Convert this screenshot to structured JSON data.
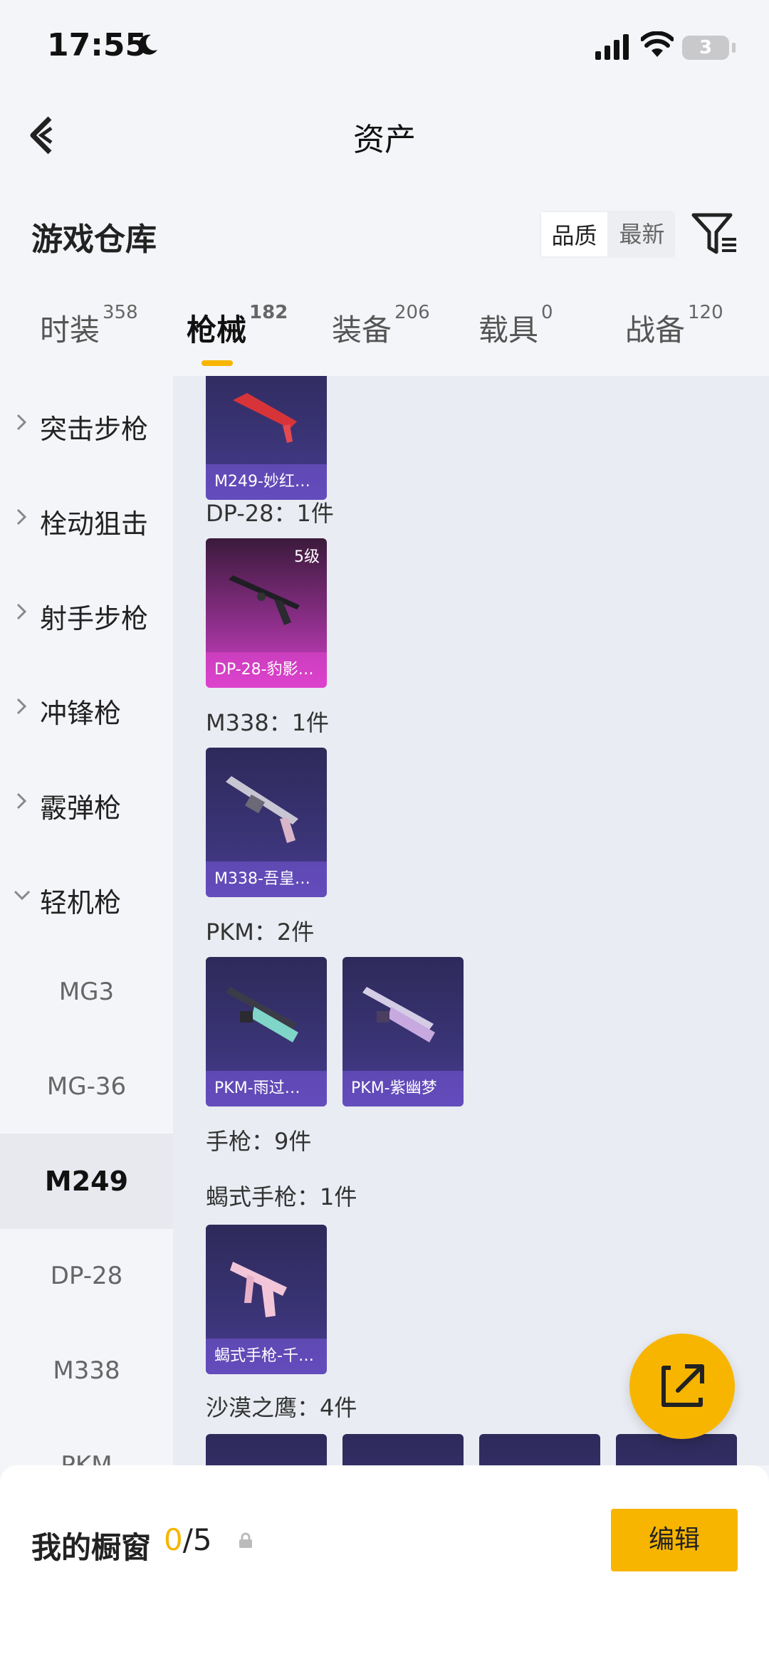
{
  "status": {
    "time": "17:55",
    "battery": "3"
  },
  "header": {
    "title": "资产"
  },
  "section": {
    "title": "游戏仓库",
    "sort_options": [
      "品质",
      "最新"
    ]
  },
  "tabs": [
    {
      "label": "时装",
      "count": "358"
    },
    {
      "label": "枪械",
      "count": "182"
    },
    {
      "label": "装备",
      "count": "206"
    },
    {
      "label": "载具",
      "count": "0"
    },
    {
      "label": "战备",
      "count": "120"
    }
  ],
  "sidebar": {
    "categories": [
      "突击步枪",
      "栓动狙击",
      "射手步枪",
      "冲锋枪",
      "霰弹枪",
      "轻机枪"
    ],
    "subitems": [
      "MG3",
      "MG-36",
      "M249",
      "DP-28",
      "M338",
      "PKM"
    ]
  },
  "content": {
    "cards": {
      "m249": "M249-妙红…",
      "dp28": "DP-28-豹影…",
      "dp28_level": "5级",
      "m338": "M338-吾皇…",
      "pkm1": "PKM-雨过…",
      "pkm2": "PKM-紫幽梦",
      "scorpion": "蝎式手枪-千…"
    },
    "groups": {
      "dp28": "DP-28：1件",
      "m338": "M338：1件",
      "pkm": "PKM：2件",
      "pistol": "手枪：9件",
      "scorpion": "蝎式手枪：1件",
      "deagle": "沙漠之鹰：4件"
    }
  },
  "showcase": {
    "label": "我的橱窗",
    "count_current": "0",
    "count_total": "/5",
    "edit_label": "编辑"
  },
  "colors": {
    "accent": "#f7b500",
    "card": "#3a3476",
    "card_purple": "#d23fc8"
  }
}
